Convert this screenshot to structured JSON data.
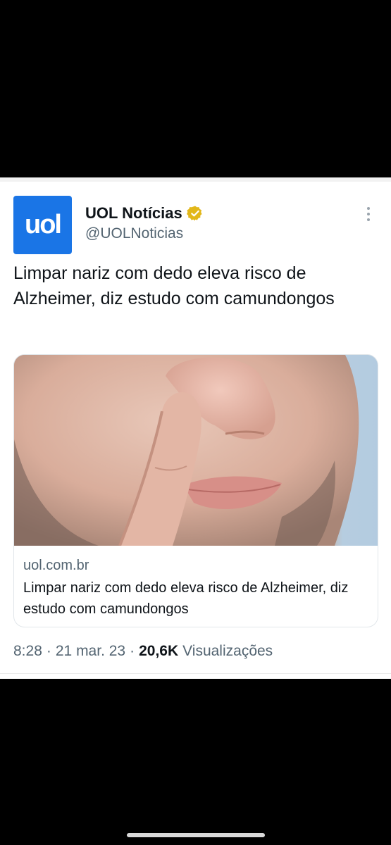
{
  "author": {
    "avatar_text": "uol",
    "display_name": "UOL Notícias",
    "handle": "@UOLNoticias",
    "verified": true
  },
  "tweet": {
    "text": "Limpar nariz com dedo eleva risco de Alzheimer, diz estudo com camundongos"
  },
  "link_card": {
    "domain": "uol.com.br",
    "title": "Limpar nariz com dedo eleva risco de Alzheimer, diz estudo com camundongos"
  },
  "meta": {
    "time": "8:28",
    "sep1": "·",
    "date": "21 mar. 23",
    "sep2": "·",
    "views_count": "20,6K",
    "views_label": "Visualizações"
  },
  "colors": {
    "brand_blue": "#1a75e6",
    "verified_gold": "#e2b719",
    "text_primary": "#0f1419",
    "text_secondary": "#536471"
  },
  "icons": {
    "verified": "verified-badge-icon",
    "more": "more-options-icon"
  }
}
